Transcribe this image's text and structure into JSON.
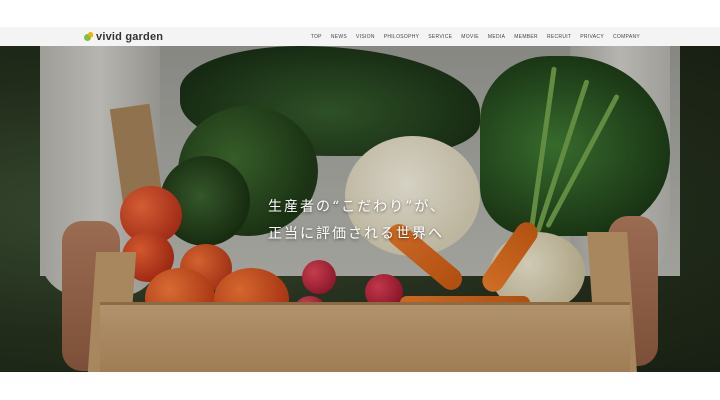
{
  "header": {
    "brand": "vivid garden",
    "nav": [
      {
        "label": "TOP"
      },
      {
        "label": "NEWS"
      },
      {
        "label": "VISION"
      },
      {
        "label": "PHILOSOPHY"
      },
      {
        "label": "SERVICE"
      },
      {
        "label": "MOVIE"
      },
      {
        "label": "MEDIA"
      },
      {
        "label": "MEMBER"
      },
      {
        "label": "RECRUIT"
      },
      {
        "label": "PRIVACY"
      },
      {
        "label": "COMPANY"
      }
    ]
  },
  "hero": {
    "line1": "生産者の“こだわり”が、",
    "line2": "正当に評価される世界へ"
  }
}
